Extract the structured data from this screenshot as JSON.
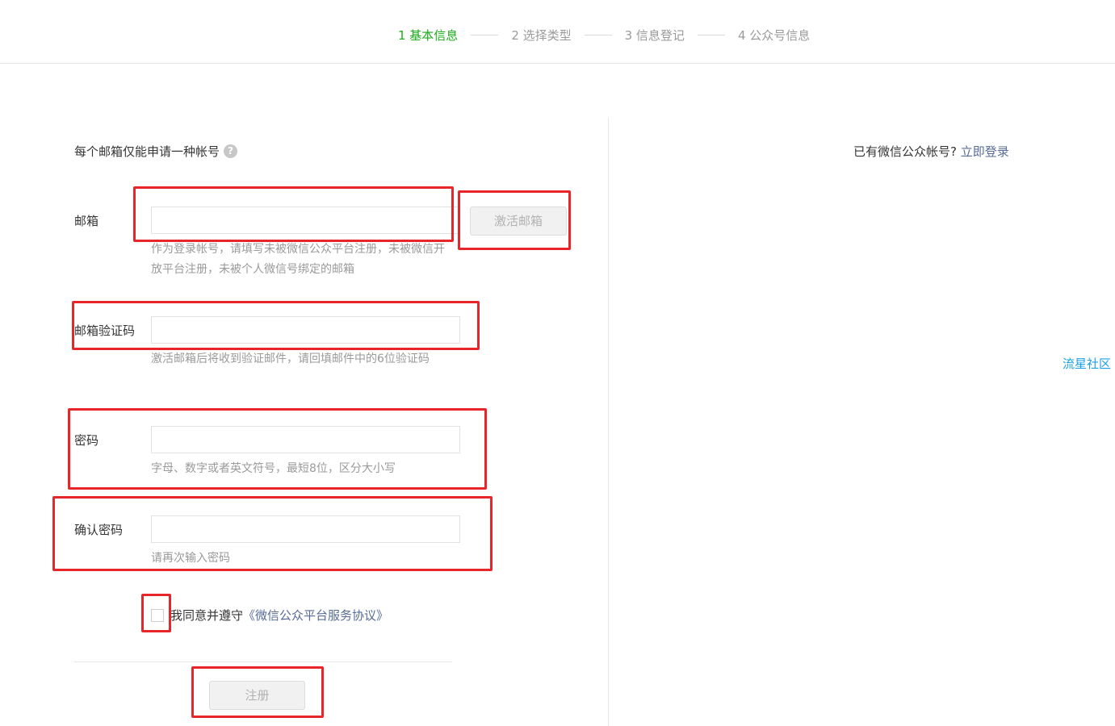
{
  "steps": [
    {
      "label": "1 基本信息",
      "active": true
    },
    {
      "label": "2 选择类型",
      "active": false
    },
    {
      "label": "3 信息登记",
      "active": false
    },
    {
      "label": "4 公众号信息",
      "active": false
    }
  ],
  "form": {
    "tip": "每个邮箱仅能申请一种帐号",
    "email": {
      "label": "邮箱",
      "value": "",
      "hint": "作为登录帐号，请填写未被微信公众平台注册，未被微信开放平台注册，未被个人微信号绑定的邮箱",
      "activate_button": "激活邮箱"
    },
    "verify_code": {
      "label": "邮箱验证码",
      "value": "",
      "hint": "激活邮箱后将收到验证邮件，请回填邮件中的6位验证码"
    },
    "password": {
      "label": "密码",
      "value": "",
      "hint": "字母、数字或者英文符号，最短8位，区分大小写"
    },
    "confirm_password": {
      "label": "确认密码",
      "value": "",
      "hint": "请再次输入密码"
    },
    "agreement": {
      "text": "我同意并遵守",
      "link": "《微信公众平台服务协议》",
      "checked": false
    },
    "register_button": "注册"
  },
  "side": {
    "login_prompt": "已有微信公众帐号?",
    "login_link": "立即登录",
    "side_link": "流星社区"
  },
  "colors": {
    "active_step": "#1aad19",
    "link": "#576b95",
    "annotation": "#e8262a"
  }
}
